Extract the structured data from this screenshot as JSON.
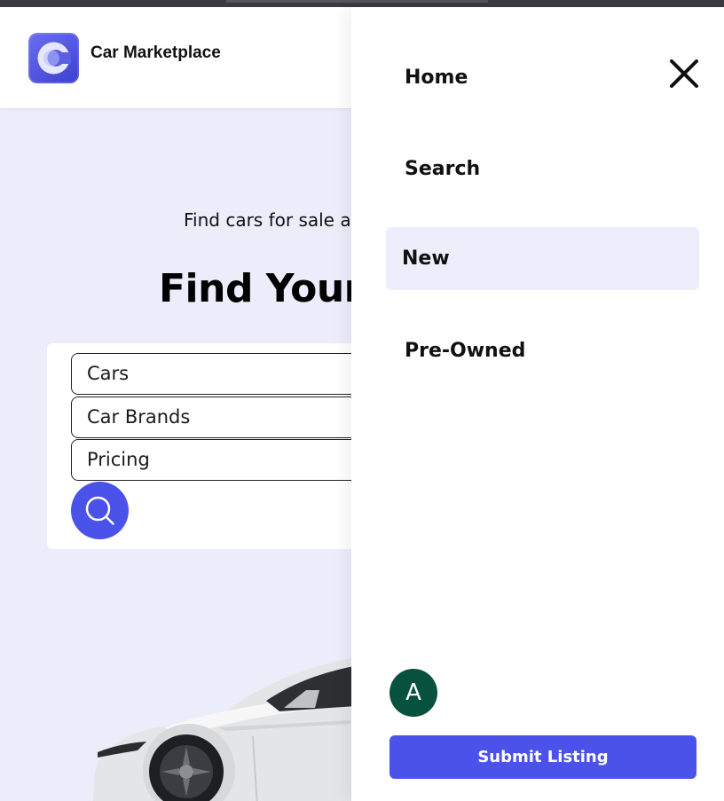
{
  "app": {
    "name": "Car Marketplace",
    "logo_icon": "letter-c-logo",
    "brand_color": "#4a52ea"
  },
  "hero": {
    "tagline": "Find cars for sale a",
    "heading": "Find Your"
  },
  "search": {
    "fields": [
      "Cars",
      "Car Brands",
      "Pricing"
    ],
    "button_icon": "search-icon"
  },
  "drawer": {
    "close_icon": "close-icon",
    "menu": [
      {
        "label": "Home",
        "active": false
      },
      {
        "label": "Search",
        "active": false
      },
      {
        "label": "New",
        "active": true
      },
      {
        "label": "Pre-Owned",
        "active": false
      }
    ],
    "avatar_initial": "A",
    "avatar_color": "#07513f",
    "submit_label": "Submit Listing"
  }
}
